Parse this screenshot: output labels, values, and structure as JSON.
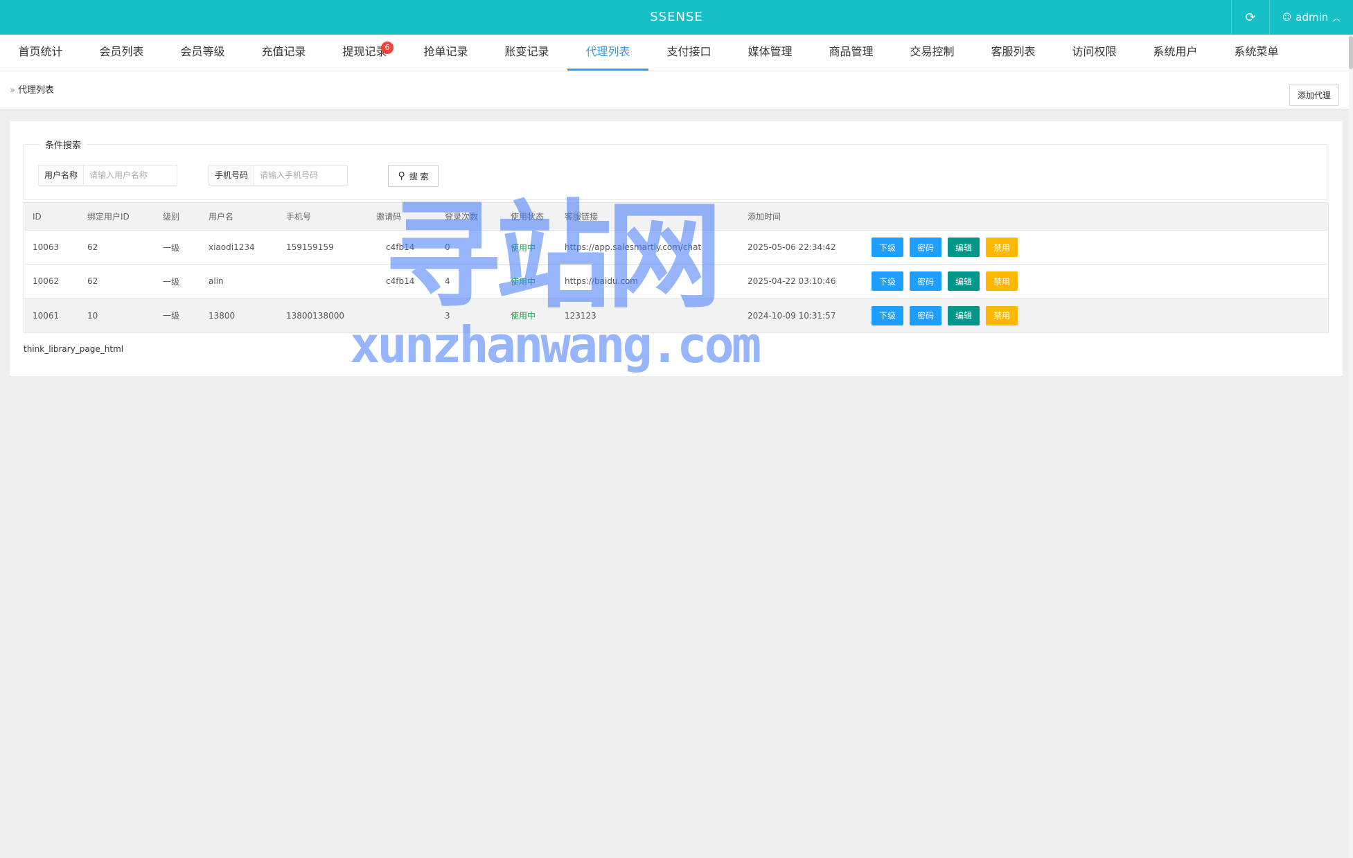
{
  "header": {
    "brand": "SSENSE",
    "refresh_icon": "refresh-icon",
    "user_name": "admin"
  },
  "nav": {
    "items": [
      {
        "label": "首页统计"
      },
      {
        "label": "会员列表"
      },
      {
        "label": "会员等级"
      },
      {
        "label": "充值记录"
      },
      {
        "label": "提现记录",
        "badge": "6"
      },
      {
        "label": "抢单记录"
      },
      {
        "label": "账变记录"
      },
      {
        "label": "代理列表",
        "active": true
      },
      {
        "label": "支付接口"
      },
      {
        "label": "媒体管理"
      },
      {
        "label": "商品管理"
      },
      {
        "label": "交易控制"
      },
      {
        "label": "客服列表"
      },
      {
        "label": "访问权限"
      },
      {
        "label": "系统用户"
      },
      {
        "label": "系统菜单"
      }
    ]
  },
  "breadcrumb": {
    "current": "代理列表"
  },
  "toolbar": {
    "add_label": "添加代理"
  },
  "search": {
    "legend": "条件搜索",
    "username_label": "用户名称",
    "username_placeholder": "请输入用户名称",
    "phone_label": "手机号码",
    "phone_placeholder": "请输入手机号码",
    "button_label": "搜 索"
  },
  "table": {
    "columns": [
      "ID",
      "绑定用户ID",
      "级别",
      "用户名",
      "手机号",
      "邀请码",
      "登录次数",
      "使用状态",
      "客服链接",
      "添加时间"
    ],
    "rows": [
      {
        "id": "10063",
        "bind_uid": "62",
        "level": "一级",
        "username": "xiaodi1234",
        "phone": "159159159",
        "invite": "c4fb14",
        "logins": "0",
        "status": "使用中",
        "link": "https://app.salesmartly.com/chat",
        "time": "2025-05-06 22:34:42"
      },
      {
        "id": "10062",
        "bind_uid": "62",
        "level": "一级",
        "username": "alin",
        "phone": "",
        "invite": "c4fb14",
        "logins": "4",
        "status": "使用中",
        "link": "https://baidu.com",
        "time": "2025-04-22 03:10:46"
      },
      {
        "id": "10061",
        "bind_uid": "10",
        "level": "一级",
        "username": "13800",
        "phone": "13800138000",
        "invite": "",
        "logins": "3",
        "status": "使用中",
        "link": "123123",
        "time": "2024-10-09 10:31:57"
      }
    ],
    "actions": [
      "下级",
      "密码",
      "编辑",
      "禁用"
    ]
  },
  "footer_text": "think_library_page_html",
  "watermark": {
    "cn": "寻站网",
    "en": "xunzhanwang.com"
  },
  "colors": {
    "header": "#16c0c6",
    "active_tab": "#3b9be0",
    "badge": "#f44336",
    "btn_blue": "#1e9fff",
    "btn_green": "#009688",
    "btn_yellow": "#ffb800"
  }
}
